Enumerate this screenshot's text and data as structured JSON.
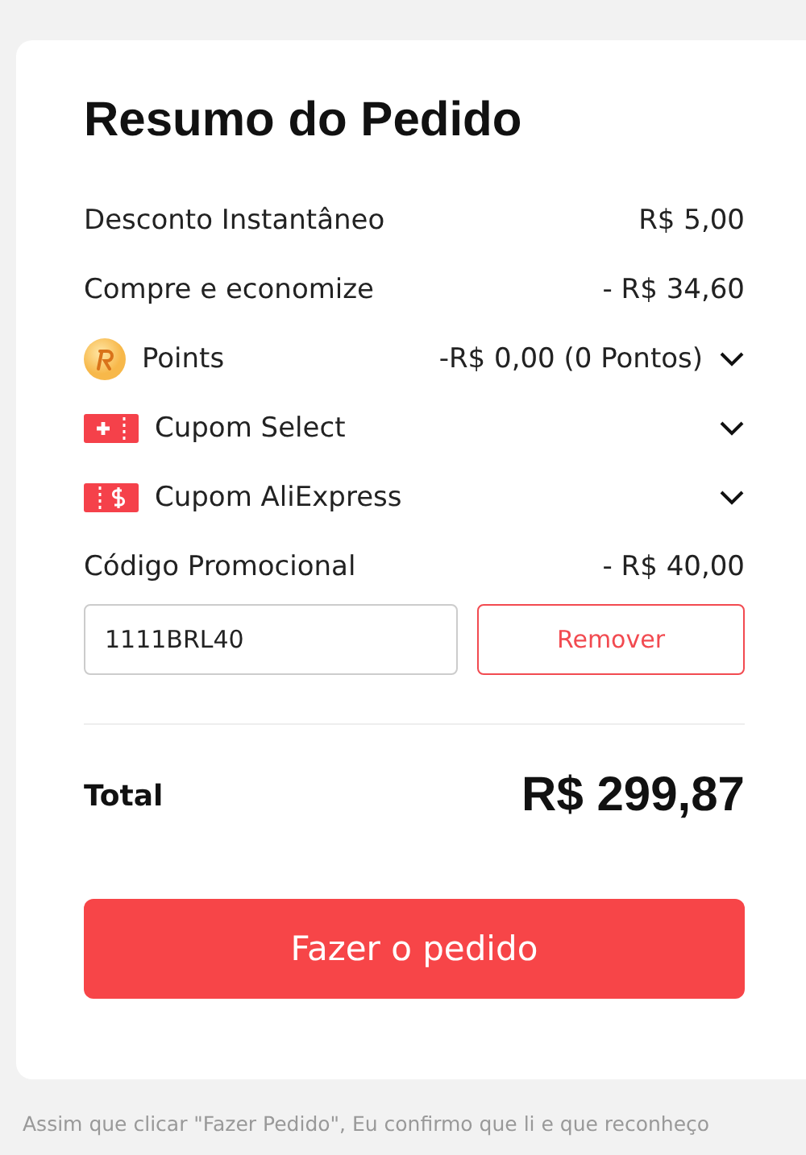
{
  "title": "Resumo do Pedido",
  "rows": [
    {
      "kind": "plain",
      "label": "Desconto Instantâneo",
      "value": "R$ 5,00"
    },
    {
      "kind": "plain",
      "label": "Compre e economize",
      "value": "- R$ 34,60"
    },
    {
      "kind": "points",
      "label": "Points",
      "value": "-R$ 0,00 (0 Pontos)"
    },
    {
      "kind": "select-coupon",
      "label": "Cupom Select"
    },
    {
      "kind": "store-coupon",
      "label": "Cupom AliExpress"
    },
    {
      "kind": "plain",
      "label": "Código Promocional",
      "value": "- R$ 40,00"
    }
  ],
  "promo": {
    "value": "1111BRL40",
    "button": "Remover"
  },
  "total": {
    "label": "Total",
    "value": "R$ 299,87"
  },
  "order_button": "Fazer o pedido",
  "footer": "Assim que clicar \"Fazer Pedido\", Eu confirmo que li e que reconheço"
}
